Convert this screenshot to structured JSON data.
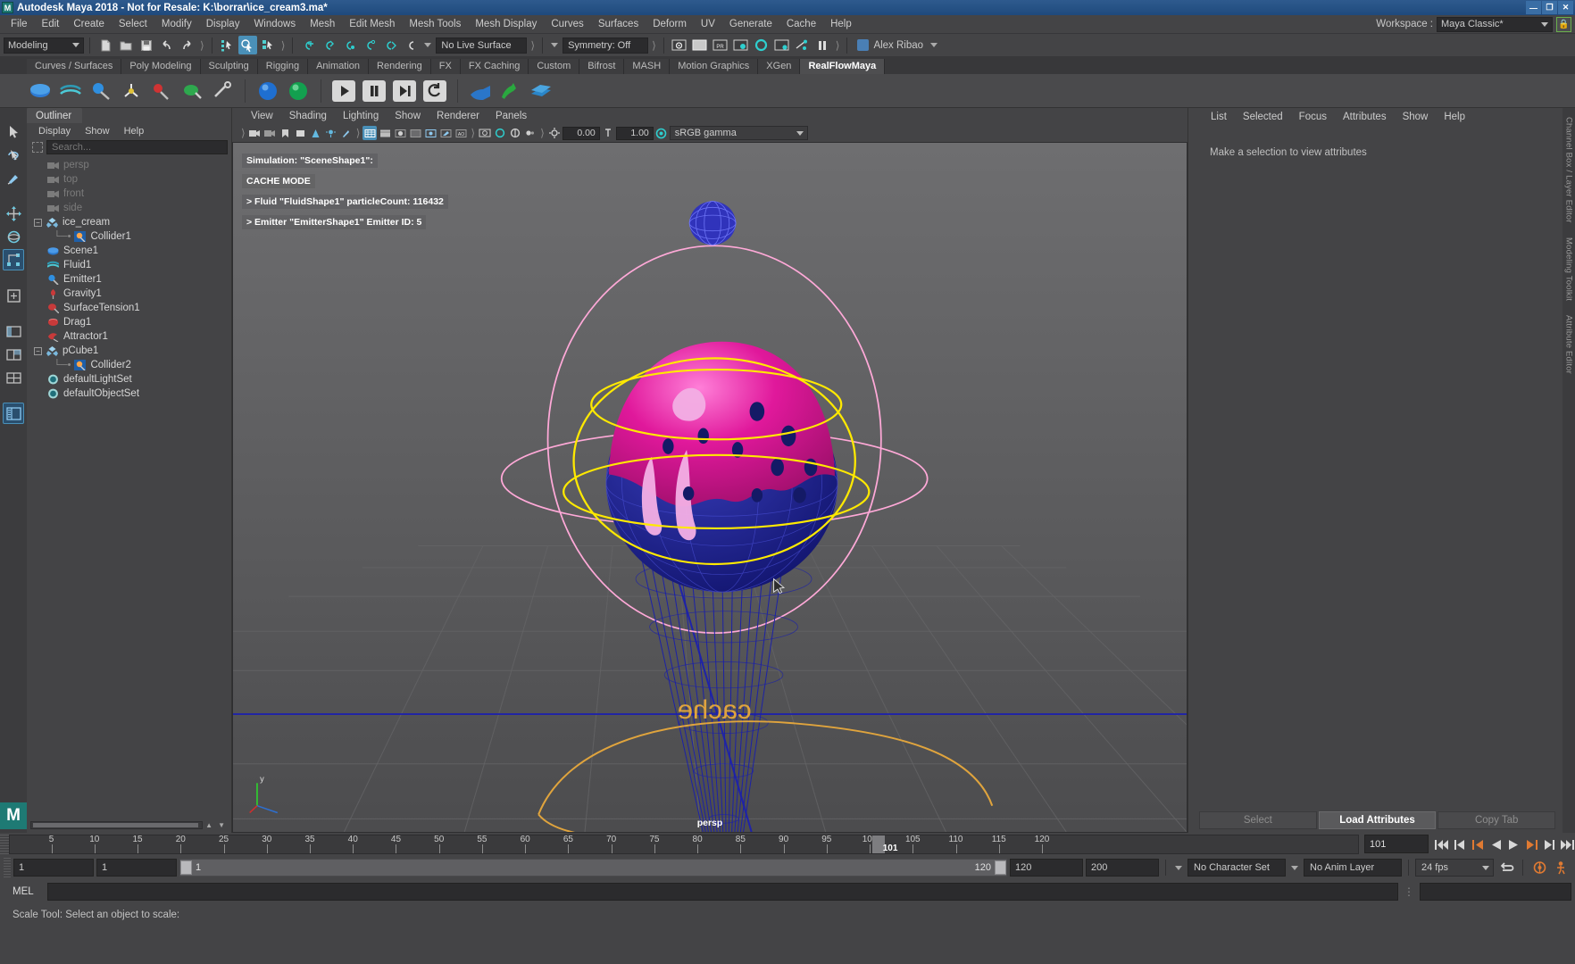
{
  "title_bar": {
    "title": "Autodesk Maya 2018 - Not for Resale: K:\\borrar\\ice_cream3.ma*",
    "logo": "M",
    "minimize": "—",
    "maximize": "❐",
    "close": "✕"
  },
  "menu_bar": {
    "items": [
      "File",
      "Edit",
      "Create",
      "Select",
      "Modify",
      "Display",
      "Windows",
      "Mesh",
      "Edit Mesh",
      "Mesh Tools",
      "Mesh Display",
      "Curves",
      "Surfaces",
      "Deform",
      "UV",
      "Generate",
      "Cache",
      "Help"
    ],
    "workspace_label": "Workspace :",
    "workspace_value": "Maya Classic*",
    "lock_icon": "lock-icon"
  },
  "status_toolbar": {
    "menuset": "Modeling",
    "live_surface": "No Live Surface",
    "symmetry": "Symmetry: Off",
    "user": "Alex Ribao",
    "icons": [
      "new-scene-icon",
      "open-scene-icon",
      "save-scene-icon",
      "undo-icon",
      "redo-icon",
      "select-hierarchy-icon",
      "select-object-icon",
      "select-component-icon",
      "snap-grid-icon",
      "snap-curve-icon",
      "snap-point-icon",
      "snap-projected-icon",
      "snap-view-plane-icon",
      "make-live-icon",
      "render-current-frame-icon",
      "ipr-render-icon",
      "render-settings-icon",
      "hypershade-icon",
      "render-view-icon",
      "render-sequence-icon",
      "light-fx-icon",
      "pause-icon"
    ]
  },
  "shelf": {
    "tabs": [
      "Curves / Surfaces",
      "Poly Modeling",
      "Sculpting",
      "Rigging",
      "Animation",
      "Rendering",
      "FX",
      "FX Caching",
      "Custom",
      "Bifrost",
      "MASH",
      "Motion Graphics",
      "XGen",
      "RealFlowMaya"
    ],
    "active_tab": "RealFlowMaya",
    "icons": [
      "realflow-scene-icon",
      "realflow-mesh-icon",
      "realflow-emitter-icon",
      "realflow-daemon-icon",
      "realflow-particles-icon",
      "realflow-tool-icon",
      "realflow-sphere-blue-icon",
      "realflow-sphere-green-icon",
      "play-icon",
      "pause-icon",
      "step-forward-icon",
      "reset-icon",
      "realflow-cache-blue-icon",
      "realflow-cache-green-icon",
      "realflow-export-icon"
    ]
  },
  "toolbox": {
    "tools": [
      "select-tool",
      "lasso-select-tool",
      "paint-select-tool",
      "move-tool",
      "rotate-tool",
      "scale-tool",
      "last-tool-used",
      "snap-toggle-icon",
      "layout-single-icon",
      "layout-two-pane-icon",
      "layout-four-pane-icon",
      "layout-persp-outliner-icon"
    ],
    "selected_tool": "scale-tool"
  },
  "outliner": {
    "tab": "Outliner",
    "menu": [
      "Display",
      "Show",
      "Help"
    ],
    "search_placeholder": "Search...",
    "nodes": [
      {
        "label": "persp",
        "icon": "camera-icon",
        "indent": 1,
        "dim": true,
        "expander": false,
        "childline": false
      },
      {
        "label": "top",
        "icon": "camera-icon",
        "indent": 1,
        "dim": true,
        "expander": false,
        "childline": false
      },
      {
        "label": "front",
        "icon": "camera-icon",
        "indent": 1,
        "dim": true,
        "expander": false,
        "childline": false
      },
      {
        "label": "side",
        "icon": "camera-icon",
        "indent": 1,
        "dim": true,
        "expander": false,
        "childline": false
      },
      {
        "label": "ice_cream",
        "icon": "transform-icon",
        "indent": 0,
        "dim": false,
        "expander": true,
        "childline": false
      },
      {
        "label": "Collider1",
        "icon": "collider-icon",
        "indent": 2,
        "dim": false,
        "expander": false,
        "childline": true
      },
      {
        "label": "Scene1",
        "icon": "rf-scene-icon",
        "indent": 1,
        "dim": false,
        "expander": false,
        "childline": false
      },
      {
        "label": "Fluid1",
        "icon": "rf-fluid-icon",
        "indent": 1,
        "dim": false,
        "expander": false,
        "childline": false
      },
      {
        "label": "Emitter1",
        "icon": "rf-emitter-icon",
        "indent": 1,
        "dim": false,
        "expander": false,
        "childline": false
      },
      {
        "label": "Gravity1",
        "icon": "rf-gravity-icon",
        "indent": 1,
        "dim": false,
        "expander": false,
        "childline": false
      },
      {
        "label": "SurfaceTension1",
        "icon": "rf-surfacetension-icon",
        "indent": 1,
        "dim": false,
        "expander": false,
        "childline": false
      },
      {
        "label": "Drag1",
        "icon": "rf-drag-icon",
        "indent": 1,
        "dim": false,
        "expander": false,
        "childline": false
      },
      {
        "label": "Attractor1",
        "icon": "rf-attractor-icon",
        "indent": 1,
        "dim": false,
        "expander": false,
        "childline": false
      },
      {
        "label": "pCube1",
        "icon": "transform-icon",
        "indent": 0,
        "dim": false,
        "expander": true,
        "childline": false
      },
      {
        "label": "Collider2",
        "icon": "collider-icon",
        "indent": 2,
        "dim": false,
        "expander": false,
        "childline": true
      },
      {
        "label": "defaultLightSet",
        "icon": "set-icon",
        "indent": 1,
        "dim": false,
        "expander": false,
        "childline": false
      },
      {
        "label": "defaultObjectSet",
        "icon": "set-icon",
        "indent": 1,
        "dim": false,
        "expander": false,
        "childline": false
      }
    ]
  },
  "viewport": {
    "menu": [
      "View",
      "Shading",
      "Lighting",
      "Show",
      "Renderer",
      "Panels"
    ],
    "exposure_value": "0.00",
    "gamma_value": "1.00",
    "color_profile": "sRGB gamma",
    "camera_label": "persp",
    "hud": [
      "Simulation: \"SceneShape1\":",
      "CACHE MODE",
      "> Fluid \"FluidShape1\" particleCount: 116432",
      "> Emitter \"EmitterShape1\" Emitter ID: 5"
    ],
    "colors": {
      "background_top": "#6b6b6d",
      "background_bottom": "#4e4e50",
      "grid": "#5b5b5d",
      "axis": "#2222aa",
      "manipulator_yellow": "#ffee00",
      "manipulator_pink": "#ff9fd0",
      "fluid_magenta": "#e0189b",
      "fluid_pink": "#f2a6dd",
      "mesh_blue": "#1a1f9e",
      "cone_outline": "#1a1f9e",
      "cache_text": "#e0a83a"
    },
    "cache_text": "cache"
  },
  "attribute_editor": {
    "menu": [
      "List",
      "Selected",
      "Focus",
      "Attributes",
      "Show",
      "Help"
    ],
    "empty_message": "Make a selection to view attributes",
    "buttons": [
      "Select",
      "Load Attributes",
      "Copy Tab"
    ],
    "active_button": "Load Attributes",
    "side_tabs": [
      "Channel Box / Layer Editor",
      "Modeling Toolkit",
      "Attribute Editor"
    ]
  },
  "timeline": {
    "ticks": [
      5,
      10,
      15,
      20,
      25,
      30,
      35,
      40,
      45,
      50,
      55,
      60,
      65,
      70,
      75,
      80,
      85,
      90,
      95,
      100,
      105,
      110,
      115,
      120
    ],
    "range_start": 1,
    "range_end": 120,
    "current_frame": "101",
    "current_frame_field": "101",
    "playback_icons": [
      "go-to-start-icon",
      "step-back-keyframe-icon",
      "step-back-frame-icon",
      "play-backwards-icon",
      "play-forwards-icon",
      "step-forward-frame-icon",
      "step-forward-keyframe-icon",
      "go-to-end-icon"
    ]
  },
  "range_bar": {
    "anim_start": "1",
    "range_start": "1",
    "slider_min": "1",
    "slider_max": "120",
    "range_end": "120",
    "anim_end": "200",
    "character_set": "No Character Set",
    "anim_layer": "No Anim Layer",
    "fps": "24 fps",
    "icons": [
      "loop-playback-icon",
      "auto-key-icon",
      "animation-preferences-icon"
    ]
  },
  "command_line": {
    "language": "MEL",
    "input_value": "",
    "help_line": "Scale Tool: Select an object to scale:"
  }
}
